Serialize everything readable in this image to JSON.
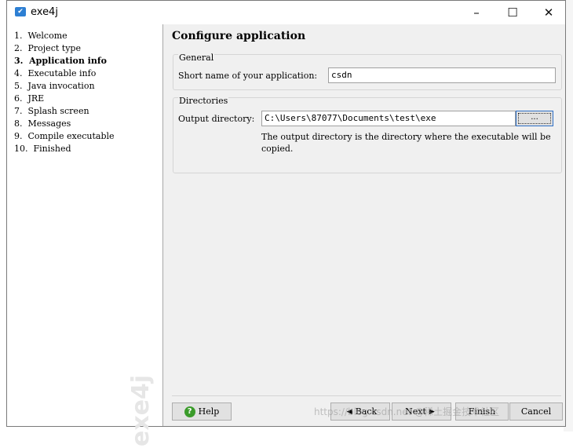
{
  "window": {
    "title": "exe4j"
  },
  "steps": [
    {
      "label": "1.  Welcome"
    },
    {
      "label": "2.  Project type"
    },
    {
      "label": "3.  Application info",
      "active": true
    },
    {
      "label": "4.  Executable info"
    },
    {
      "label": "5.  Java invocation"
    },
    {
      "label": "6.  JRE"
    },
    {
      "label": "7.  Splash screen"
    },
    {
      "label": "8.  Messages"
    },
    {
      "label": "9.  Compile executable"
    },
    {
      "label": "10.  Finished"
    }
  ],
  "sidebar": {
    "watermark": "exe4j"
  },
  "content": {
    "title": "Configure application",
    "general": {
      "legend": "General",
      "short_name_label": "Short name of your application:",
      "short_name_value": "csdn"
    },
    "directories": {
      "legend": "Directories",
      "output_label": "Output directory:",
      "output_value": "C:\\Users\\87077\\Documents\\test\\exe",
      "browse_label": "...",
      "hint": "The output directory is the directory where the executable will be copied."
    }
  },
  "buttons": {
    "help": "Help",
    "back": "Back",
    "next": "Next",
    "finish": "Finish",
    "cancel": "Cancel"
  },
  "footer_watermark": "https://blog.csdn.net   @稀土掘金技术社区"
}
